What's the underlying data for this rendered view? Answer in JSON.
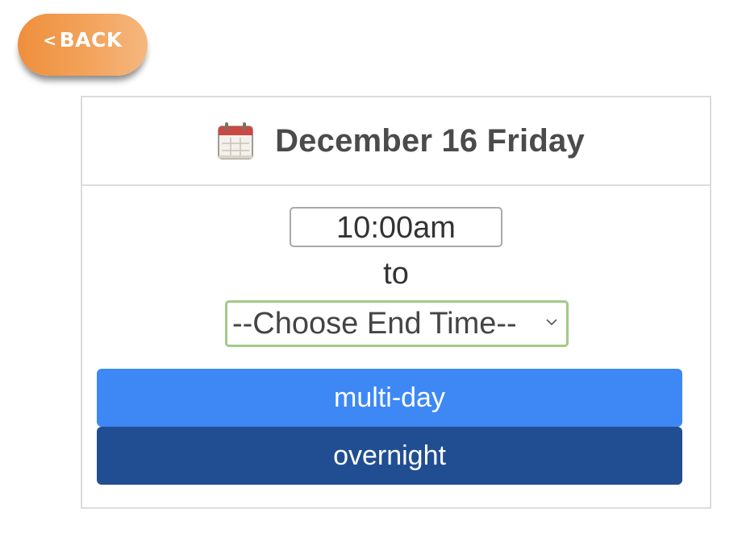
{
  "back_button": {
    "chevron": "<",
    "label": "BACK"
  },
  "header": {
    "icon": "calendar-icon",
    "date_label": "December 16 Friday"
  },
  "time": {
    "start_value": "10:00am",
    "to_label": "to",
    "end_select_value": "--Choose End Time--"
  },
  "buttons": {
    "multi_day": "multi-day",
    "overnight": "overnight"
  },
  "colors": {
    "back_button": "#ee8f3c",
    "multi_day_button": "#3d88f5",
    "overnight_button": "#214e92",
    "select_border": "#9fcb86"
  }
}
